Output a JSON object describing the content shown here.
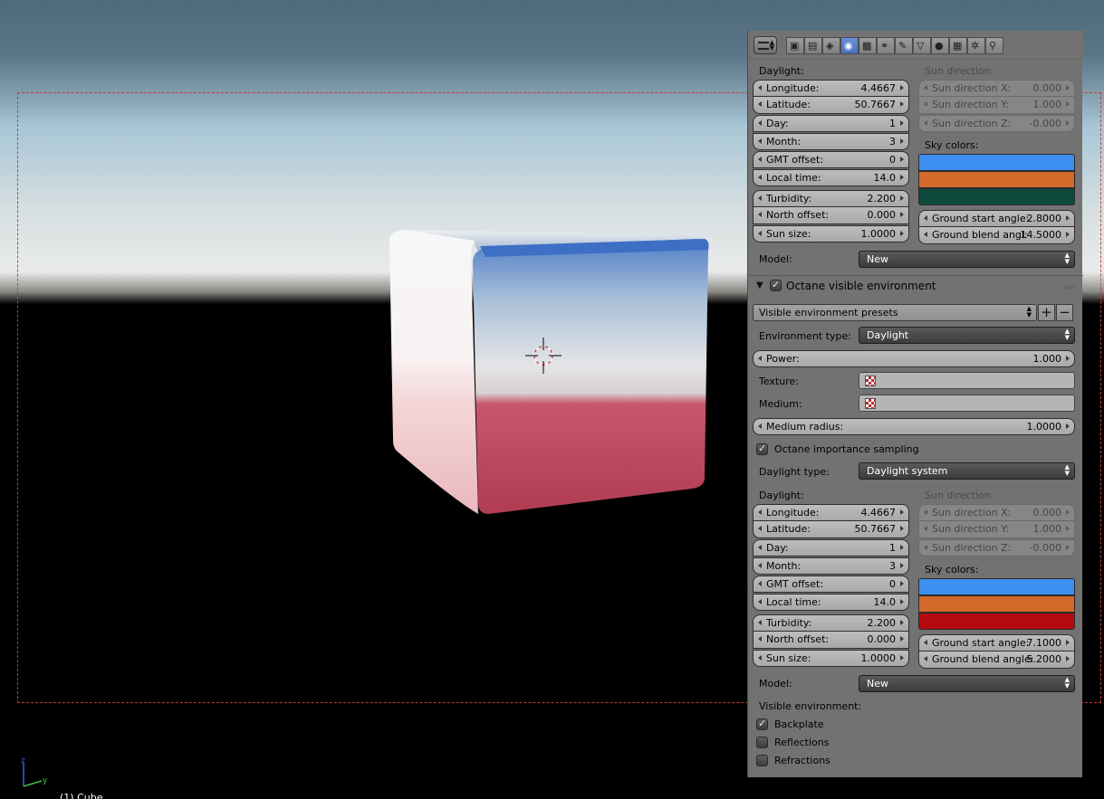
{
  "viewport": {
    "object_label": "(1) Cube",
    "axis_z": "z",
    "axis_y": "y"
  },
  "tabs": [
    "render-tab-icon",
    "render-layers-tab-icon",
    "scene-tab-icon",
    "world-tab-icon",
    "object-tab-icon",
    "constraints-tab-icon",
    "modifiers-tab-icon",
    "data-tab-icon",
    "material-tab-icon",
    "texture-tab-icon",
    "particles-tab-icon",
    "physics-tab-icon"
  ],
  "active_tab": 3,
  "top": {
    "daylight_label": "Daylight:",
    "sun_direction_label": "Sun direction:",
    "longitude": {
      "label": "Longitude:",
      "value": "4.4667"
    },
    "latitude": {
      "label": "Latitude:",
      "value": "50.7667"
    },
    "day": {
      "label": "Day:",
      "value": "1"
    },
    "month": {
      "label": "Month:",
      "value": "3"
    },
    "gmt": {
      "label": "GMT offset:",
      "value": "0"
    },
    "local_time": {
      "label": "Local time:",
      "value": "14.0"
    },
    "turbidity": {
      "label": "Turbidity:",
      "value": "2.200"
    },
    "north_offset": {
      "label": "North offset:",
      "value": "0.000"
    },
    "sun_size": {
      "label": "Sun size:",
      "value": "1.0000"
    },
    "sun_x": {
      "label": "Sun direction X:",
      "value": "0.000"
    },
    "sun_y": {
      "label": "Sun direction Y:",
      "value": "1.000"
    },
    "sun_z": {
      "label": "Sun direction Z:",
      "value": "-0.000"
    },
    "sky_colors_label": "Sky colors:",
    "sky_colors": [
      "#3d8ff0",
      "#d4692c",
      "#0f4a3c"
    ],
    "ground_start": {
      "label": "Ground start angle:",
      "value": "2.8000"
    },
    "ground_blend": {
      "label": "Ground blend angl:",
      "value": "14.5000"
    },
    "model_label": "Model:",
    "model_value": "New"
  },
  "section": {
    "title": "Octane visible environment",
    "presets": "Visible environment presets",
    "env_type_label": "Environment type:",
    "env_type_value": "Daylight",
    "power": {
      "label": "Power:",
      "value": "1.000"
    },
    "texture_label": "Texture:",
    "medium_label": "Medium:",
    "medium_radius": {
      "label": "Medium radius:",
      "value": "1.0000"
    },
    "importance_label": "Octane importance sampling",
    "daylight_type_label": "Daylight type:",
    "daylight_type_value": "Daylight system"
  },
  "bottom": {
    "daylight_label": "Daylight:",
    "sun_direction_label": "Sun direction:",
    "longitude": {
      "label": "Longitude:",
      "value": "4.4667"
    },
    "latitude": {
      "label": "Latitude:",
      "value": "50.7667"
    },
    "day": {
      "label": "Day:",
      "value": "1"
    },
    "month": {
      "label": "Month:",
      "value": "3"
    },
    "gmt": {
      "label": "GMT offset:",
      "value": "0"
    },
    "local_time": {
      "label": "Local time:",
      "value": "14.0"
    },
    "turbidity": {
      "label": "Turbidity:",
      "value": "2.200"
    },
    "north_offset": {
      "label": "North offset:",
      "value": "0.000"
    },
    "sun_size": {
      "label": "Sun size:",
      "value": "1.0000"
    },
    "sun_x": {
      "label": "Sun direction X:",
      "value": "0.000"
    },
    "sun_y": {
      "label": "Sun direction Y:",
      "value": "1.000"
    },
    "sun_z": {
      "label": "Sun direction Z:",
      "value": "-0.000"
    },
    "sky_colors_label": "Sky colors:",
    "sky_colors": [
      "#3d8ff0",
      "#d4692c",
      "#b50a12"
    ],
    "ground_start": {
      "label": "Ground start angle:",
      "value": "7.1000"
    },
    "ground_blend": {
      "label": "Ground blend angle:",
      "value": "5.2000"
    },
    "model_label": "Model:",
    "model_value": "New"
  },
  "visible_env": {
    "label": "Visible environment:",
    "backplate": {
      "label": "Backplate",
      "checked": true
    },
    "reflections": {
      "label": "Reflections",
      "checked": false
    },
    "refractions": {
      "label": "Refractions",
      "checked": false
    }
  }
}
